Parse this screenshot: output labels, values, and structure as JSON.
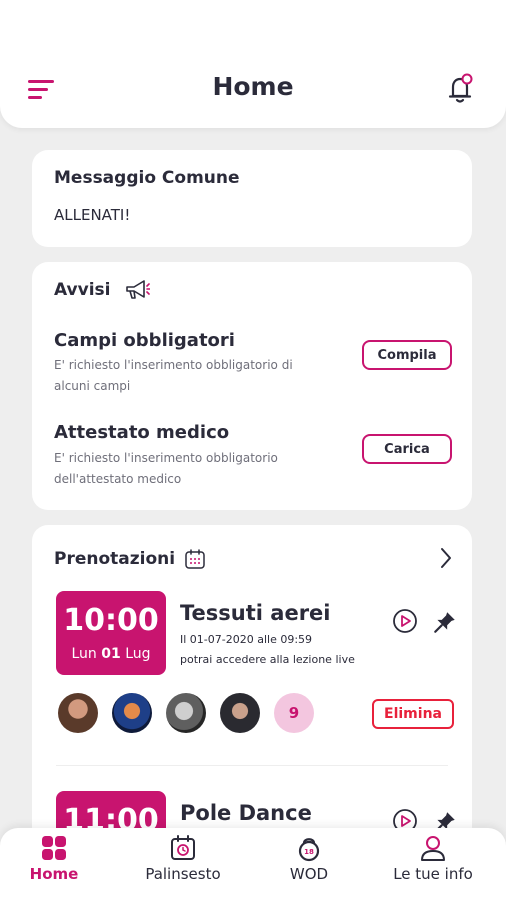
{
  "header": {
    "title": "Home",
    "menu_icon": "hamburger-menu-icon",
    "notification_icon": "bell-icon"
  },
  "message_card": {
    "title": "Messaggio Comune",
    "text": "ALLENATI!"
  },
  "notices_card": {
    "title": "Avvisi",
    "icon": "megaphone-icon",
    "items": [
      {
        "title": "Campi obbligatori",
        "description": "E' richiesto l'inserimento obbligatorio di alcuni campi",
        "button_label": "Compila"
      },
      {
        "title": "Attestato medico",
        "description": "E' richiesto l'inserimento obbligatorio dell'attestato medico",
        "button_label": "Carica"
      }
    ]
  },
  "bookings_card": {
    "title": "Prenotazioni",
    "icon": "calendar-icon",
    "bookings": [
      {
        "time": "10:00",
        "day_name": "Lun",
        "day_number": "01",
        "month": "Lug",
        "title": "Tessuti aerei",
        "subtitle_line1": "Il 01-07-2020 alle 09:59",
        "subtitle_line2": "potrai accedere alla lezione live",
        "participant_count": "9",
        "delete_label": "Elimina"
      },
      {
        "time": "11:00",
        "title": "Pole Dance"
      }
    ]
  },
  "bottom_nav": {
    "items": [
      {
        "label": "Home",
        "icon": "grid-icon",
        "active": true
      },
      {
        "label": "Palinsesto",
        "icon": "schedule-calendar-icon",
        "active": false
      },
      {
        "label": "WOD",
        "icon": "kettlebell-icon",
        "active": false
      },
      {
        "label": "Le tue info",
        "icon": "user-icon",
        "active": false
      }
    ]
  },
  "colors": {
    "accent": "#c8146f",
    "accent_light": "#f3c6df",
    "danger": "#e8213b",
    "background": "#eeeeee",
    "card": "#ffffff",
    "text": "#2b2b3a"
  }
}
